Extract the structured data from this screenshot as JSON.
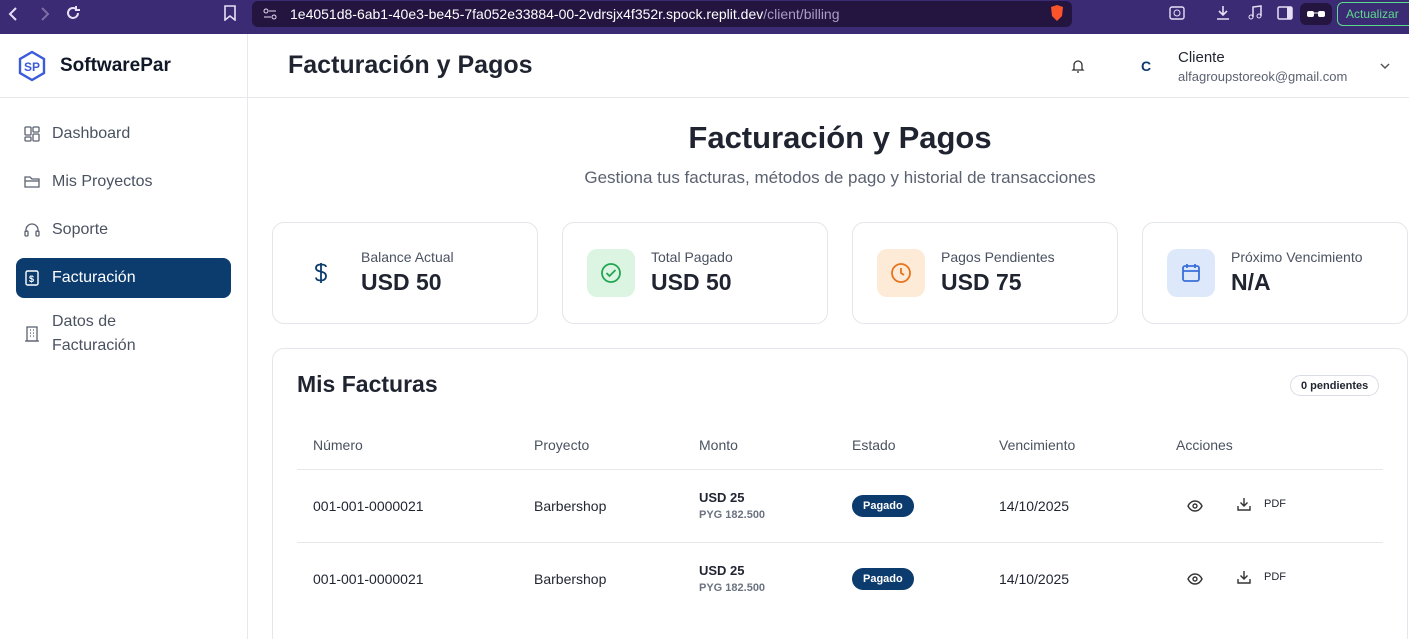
{
  "browser": {
    "url_host": "1e4051d8-6ab1-40e3-be45-7fa052e33884-00-2vdrsjx4f352r.spock.replit.dev",
    "url_path": "/client/billing",
    "update_label": "Actualizar"
  },
  "brand": {
    "name": "SoftwarePar",
    "color": "#3b5bdb"
  },
  "sidebar": {
    "items": [
      {
        "label": "Dashboard",
        "icon": "dashboard-icon"
      },
      {
        "label": "Mis Proyectos",
        "icon": "folder-icon"
      },
      {
        "label": "Soporte",
        "icon": "headphones-icon"
      },
      {
        "label": "Facturación",
        "icon": "invoice-icon",
        "active": true
      },
      {
        "label_line1": "Datos de",
        "label_line2": "Facturación",
        "icon": "building-icon"
      }
    ]
  },
  "header": {
    "title": "Facturación y Pagos",
    "user": {
      "initial": "C",
      "name": "Cliente",
      "email": "alfagroupstoreok@gmail.com"
    }
  },
  "page": {
    "title": "Facturación y Pagos",
    "subtitle": "Gestiona tus facturas, métodos de pago y historial de transacciones"
  },
  "cards": [
    {
      "label": "Balance Actual",
      "value": "USD 50",
      "icon": "dollar-icon",
      "color": "#0c3b6e",
      "bg": "#ffffff"
    },
    {
      "label": "Total Pagado",
      "value": "USD 50",
      "icon": "check-circle-icon",
      "color": "#22a650",
      "bg": "#dcf5e3"
    },
    {
      "label": "Pagos Pendientes",
      "value": "USD 75",
      "icon": "clock-icon",
      "color": "#e8731c",
      "bg": "#fdebd8"
    },
    {
      "label": "Próximo Vencimiento",
      "value": "N/A",
      "icon": "calendar-icon",
      "color": "#3b6fd8",
      "bg": "#dde9fb"
    }
  ],
  "invoices": {
    "title": "Mis Facturas",
    "pending_badge": "0 pendientes",
    "columns": [
      "Número",
      "Proyecto",
      "Monto",
      "Estado",
      "Vencimiento",
      "Acciones"
    ],
    "rows": [
      {
        "number": "001-001-0000021",
        "project": "Barbershop",
        "amount": "USD 25",
        "amount_local": "PYG 182.500",
        "status": "Pagado",
        "due": "14/10/2025",
        "pdf": "PDF"
      },
      {
        "number": "001-001-0000021",
        "project": "Barbershop",
        "amount": "USD 25",
        "amount_local": "PYG 182.500",
        "status": "Pagado",
        "due": "14/10/2025",
        "pdf": "PDF"
      }
    ]
  }
}
